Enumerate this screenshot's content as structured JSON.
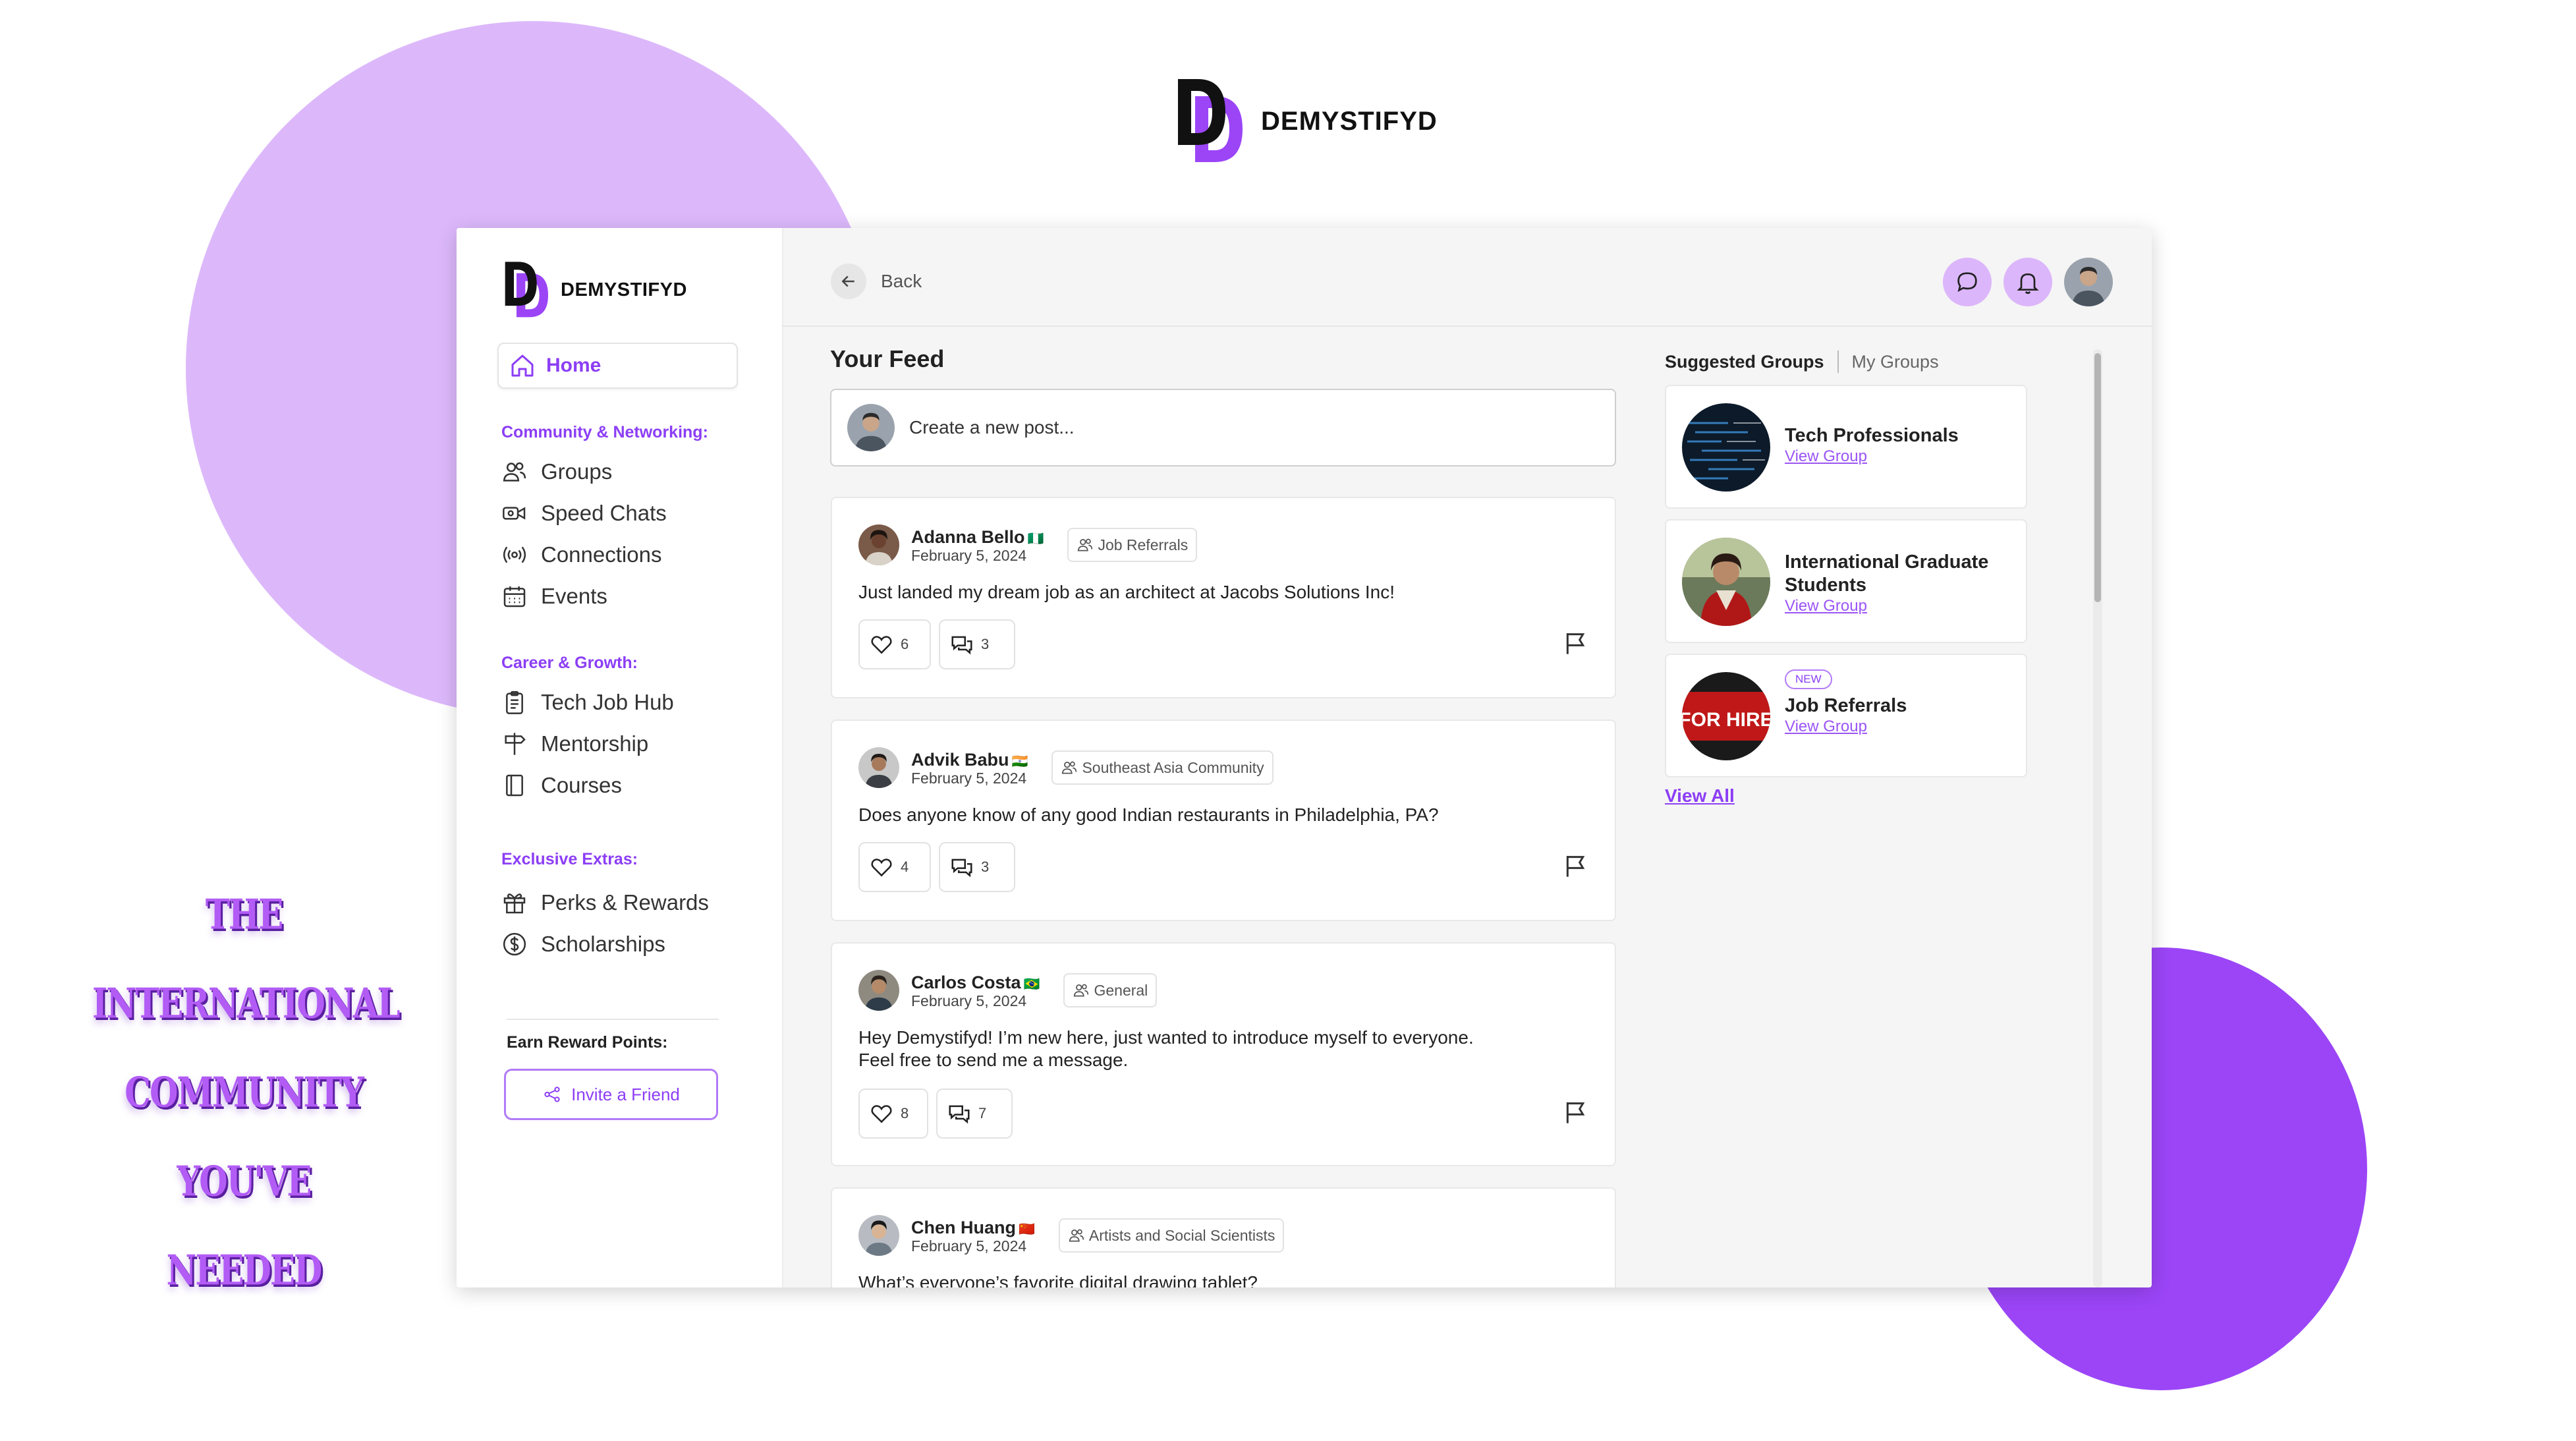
{
  "brand": {
    "name": "DEMYSTIFYD"
  },
  "colors": {
    "accent": "#8c3ef5",
    "lilac": "#dcb8fb",
    "purple": "#9b45f7"
  },
  "slogan": [
    "THE",
    "INTERNATIONAL",
    "COMMUNITY",
    "YOU'VE",
    "NEEDED"
  ],
  "sidebar": {
    "home": "Home",
    "sections": [
      {
        "label": "Community & Networking:",
        "items": [
          {
            "label": "Groups",
            "icon": "users-icon"
          },
          {
            "label": "Speed Chats",
            "icon": "video-icon"
          },
          {
            "label": "Connections",
            "icon": "broadcast-icon"
          },
          {
            "label": "Events",
            "icon": "calendar-icon"
          }
        ]
      },
      {
        "label": "Career & Growth:",
        "items": [
          {
            "label": "Tech Job Hub",
            "icon": "clipboard-icon"
          },
          {
            "label": "Mentorship",
            "icon": "signpost-icon"
          },
          {
            "label": "Courses",
            "icon": "book-icon"
          }
        ]
      },
      {
        "label": "Exclusive Extras:",
        "items": [
          {
            "label": "Perks & Rewards",
            "icon": "gift-icon"
          },
          {
            "label": "Scholarships",
            "icon": "dollar-icon"
          }
        ]
      }
    ],
    "earn_label": "Earn Reward Points:",
    "invite_label": "Invite a Friend"
  },
  "header": {
    "back_label": "Back"
  },
  "feed": {
    "title": "Your Feed",
    "create_placeholder": "Create a new post...",
    "posts": [
      {
        "author": "Adanna Bello",
        "flag": "🇳🇬",
        "date": "February 5, 2024",
        "tag": "Job Referrals",
        "text": "Just landed my dream job as an architect at Jacobs Solutions Inc!",
        "likes": "6",
        "comments": "3"
      },
      {
        "author": "Advik Babu",
        "flag": "🇮🇳",
        "date": "February 5, 2024",
        "tag": "Southeast Asia Community",
        "text": "Does anyone know of any good Indian restaurants in Philadelphia, PA?",
        "likes": "4",
        "comments": "3"
      },
      {
        "author": "Carlos Costa",
        "flag": "🇧🇷",
        "date": "February 5, 2024",
        "tag": "General",
        "text": "Hey Demystifyd! I’m new here, just wanted to introduce myself to everyone.",
        "text2": "Feel free to send me a message.",
        "likes": "8",
        "comments": "7"
      },
      {
        "author": "Chen Huang",
        "flag": "🇨🇳",
        "date": "February 5, 2024",
        "tag": "Artists and Social Scientists",
        "text": "What’s everyone’s favorite digital drawing tablet?"
      }
    ]
  },
  "groups": {
    "tab_active": "Suggested Groups",
    "tab_other": "My Groups",
    "items": [
      {
        "name": "Tech Professionals",
        "link": "View Group"
      },
      {
        "name": "International Graduate",
        "name2": "Students",
        "link": "View Group"
      },
      {
        "name": "Job Referrals",
        "badge": "NEW",
        "link": "View Group",
        "image_text": "FOR HIRE"
      }
    ],
    "view_all": "View All"
  }
}
